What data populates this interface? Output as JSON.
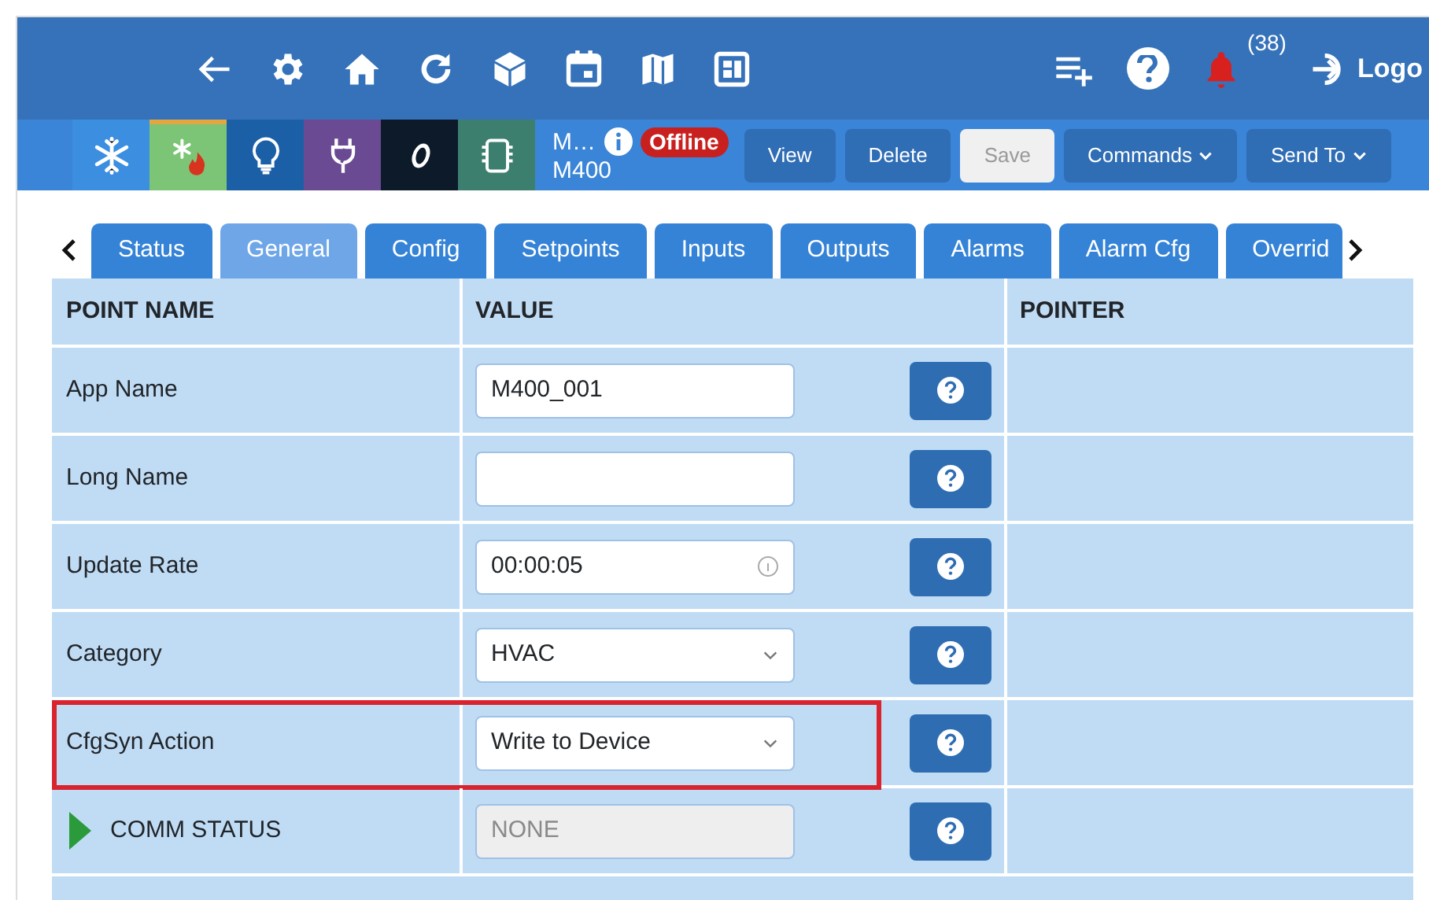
{
  "top_nav": {
    "notification_count": "(38)",
    "logout_label": "Logo"
  },
  "device_bar": {
    "device_types": [
      {
        "kind": "cooling"
      },
      {
        "kind": "heat-cool"
      },
      {
        "kind": "lighting"
      },
      {
        "kind": "power"
      },
      {
        "kind": "other"
      },
      {
        "kind": "controller"
      }
    ],
    "device_name": "M…",
    "device_model": "M400",
    "status": "Offline",
    "buttons": [
      {
        "label": "View",
        "disabled": false,
        "dropdown": false
      },
      {
        "label": "Delete",
        "disabled": false,
        "dropdown": false
      },
      {
        "label": "Save",
        "disabled": true,
        "dropdown": false
      },
      {
        "label": "Commands",
        "disabled": false,
        "dropdown": true
      },
      {
        "label": "Send To",
        "disabled": false,
        "dropdown": true
      }
    ]
  },
  "tabs": [
    {
      "label": "Status",
      "selected": false
    },
    {
      "label": "General",
      "selected": true
    },
    {
      "label": "Config",
      "selected": false
    },
    {
      "label": "Setpoints",
      "selected": false
    },
    {
      "label": "Inputs",
      "selected": false
    },
    {
      "label": "Outputs",
      "selected": false
    },
    {
      "label": "Alarms",
      "selected": false
    },
    {
      "label": "Alarm Cfg",
      "selected": false
    },
    {
      "label": "Overrid",
      "selected": false
    }
  ],
  "table": {
    "columns": [
      "POINT NAME",
      "VALUE",
      "POINTER"
    ],
    "rows": [
      {
        "name": "App Name",
        "kind": "text",
        "value": "M400_001",
        "highlighted": false,
        "expandable": false
      },
      {
        "name": "Long Name",
        "kind": "text",
        "value": "",
        "highlighted": false,
        "expandable": false
      },
      {
        "name": "Update Rate",
        "kind": "time",
        "value": "00:00:05",
        "highlighted": false,
        "expandable": false
      },
      {
        "name": "Category",
        "kind": "select",
        "value": "HVAC",
        "highlighted": false,
        "expandable": false
      },
      {
        "name": "CfgSyn Action",
        "kind": "select",
        "value": "Write to Device",
        "highlighted": true,
        "expandable": false
      },
      {
        "name": "COMM STATUS",
        "kind": "readonly",
        "value": "NONE",
        "highlighted": false,
        "expandable": true
      }
    ]
  }
}
